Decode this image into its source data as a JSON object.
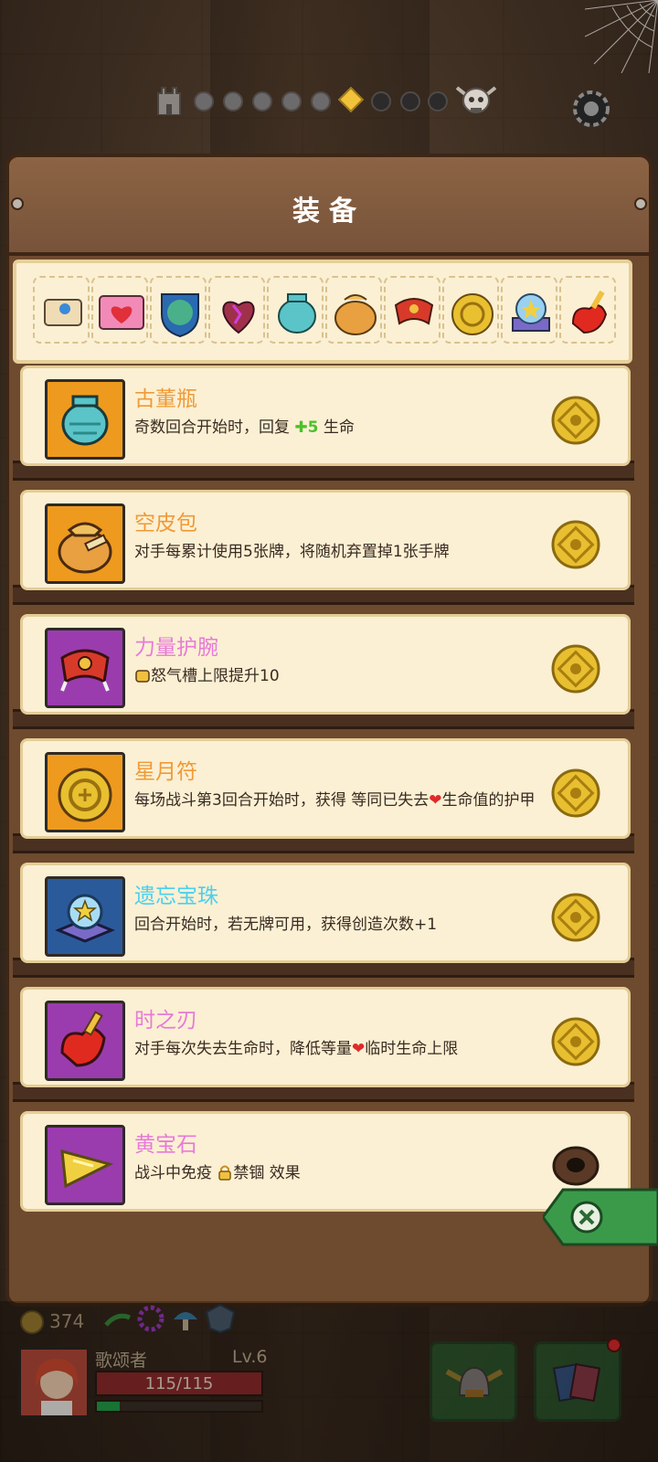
{
  "panel": {
    "title": "装备"
  },
  "progress": {
    "stages_done": 5,
    "current_stage": 6,
    "stages_total": 9
  },
  "strip_items": [
    "卷轴",
    "爱心宝箱",
    "怪物盾牌",
    "暗影之心",
    "古董瓶",
    "空皮包",
    "力量护腕",
    "星月符",
    "遗忘宝珠",
    "时之刃"
  ],
  "equipment": [
    {
      "name": "古董瓶",
      "rarity": "orange",
      "desc_pre": "奇数回合开始时，回复 ",
      "desc_plus": "✚5",
      "desc_post": " 生命",
      "icon": "vase-icon"
    },
    {
      "name": "空皮包",
      "rarity": "orange",
      "desc": "对手每累计使用5张牌，将随机弃置掉1张手牌",
      "icon": "bag-icon"
    },
    {
      "name": "力量护腕",
      "rarity": "pink",
      "desc": "怒气槽上限提升10",
      "icon": "bracer-icon"
    },
    {
      "name": "星月符",
      "rarity": "orange",
      "desc_pre": "每场战斗第3回合开始时，获得 等同已失去",
      "desc_post": "生命值的护甲",
      "icon": "amulet-icon"
    },
    {
      "name": "遗忘宝珠",
      "rarity": "cyan",
      "desc": "回合开始时，若无牌可用，获得创造次数+1",
      "icon": "orb-icon"
    },
    {
      "name": "时之刃",
      "rarity": "pink",
      "desc_pre": "对手每次失去生命时，降低等量",
      "desc_post": "临时生命上限",
      "icon": "blade-icon"
    },
    {
      "name": "黄宝石",
      "rarity": "pink",
      "desc_pre": "战斗中免疫 ",
      "desc_post": "禁锢 效果",
      "icon": "gem-icon"
    }
  ],
  "hud": {
    "gold": "374",
    "player_name": "歌颂者",
    "level": "Lv.6",
    "hp": "115/115",
    "xp_fraction": 0.14
  },
  "colors": {
    "orange": "#f09a36",
    "pink": "#e87ad8",
    "cyan": "#4ad0ee",
    "panel": "#6e4a2e",
    "card": "#fbf0d4"
  }
}
